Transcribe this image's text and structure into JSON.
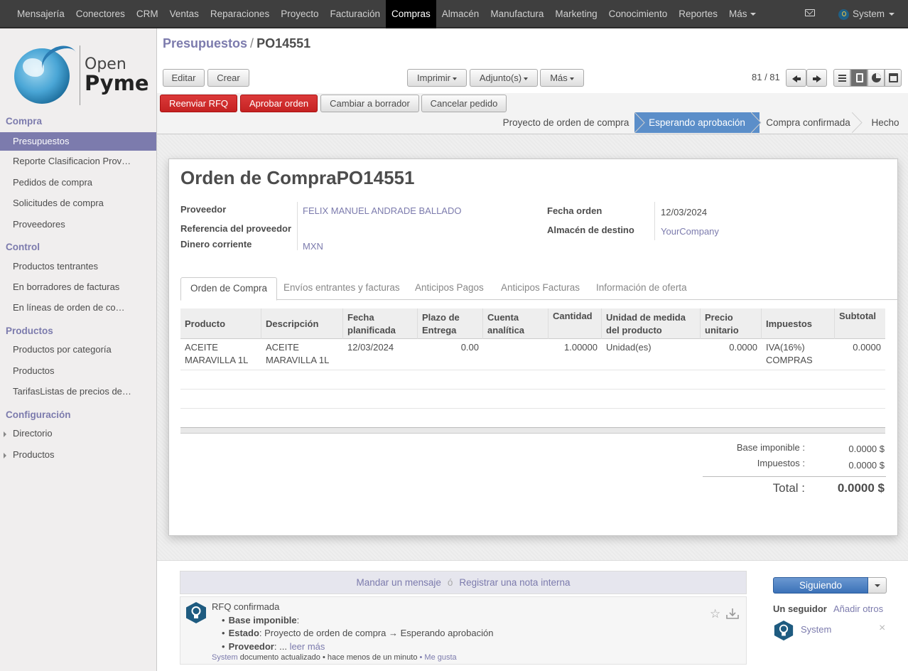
{
  "topbar": {
    "menu": [
      "Mensajería",
      "Conectores",
      "CRM",
      "Ventas",
      "Reparaciones",
      "Proyecto",
      "Facturación",
      "Compras",
      "Almacén",
      "Manufactura",
      "Marketing",
      "Conocimiento",
      "Reportes",
      "Más"
    ],
    "active_menu": "Compras",
    "user": "System"
  },
  "logo": {
    "line1": "Open",
    "line2": "Pyme"
  },
  "sidebar": {
    "sections": [
      {
        "title": "Compra",
        "items": [
          "Presupuestos",
          "Reporte Clasificacion Prov…",
          "Pedidos de compra",
          "Solicitudes de compra",
          "Proveedores"
        ]
      },
      {
        "title": "Control",
        "items": [
          "Productos tentrantes",
          "En borradores de facturas",
          "En líneas de orden de co…"
        ]
      },
      {
        "title": "Productos",
        "items": [
          "Productos por categoría",
          "Productos",
          "TarifasListas de precios de…"
        ]
      },
      {
        "title": "Configuración",
        "items": [
          "Directorio",
          "Productos"
        ]
      }
    ],
    "active_item": "Presupuestos"
  },
  "breadcrumb": {
    "parent": "Presupuestos",
    "sep": "/",
    "current": "PO14551"
  },
  "toolbar": {
    "edit": "Editar",
    "create": "Crear",
    "print": "Imprimir",
    "attach": "Adjunto(s)",
    "more": "Más",
    "pager": "81 / 81"
  },
  "actions": {
    "resend": "Reenviar RFQ",
    "approve": "Aprobar orden",
    "to_draft": "Cambiar a borrador",
    "cancel": "Cancelar pedido"
  },
  "stages": [
    "Proyecto de orden de compra",
    "Esperando aprobación",
    "Compra confirmada",
    "Hecho"
  ],
  "active_stage": "Esperando aprobación",
  "form": {
    "title": "Orden de CompraPO14551",
    "supplier_label": "Proveedor",
    "supplier": "FELIX MANUEL ANDRADE BALLADO",
    "supplier_ref_label": "Referencia del proveedor",
    "currency_label": "Dinero corriente",
    "currency": "MXN",
    "date_label": "Fecha orden",
    "date": "12/03/2024",
    "warehouse_label": "Almacén de destino",
    "warehouse": "YourCompany"
  },
  "tabs": [
    "Orden de Compra",
    "Envíos entrantes y facturas",
    "Anticipos Pagos",
    "Anticipos Facturas",
    "Información de oferta"
  ],
  "grid": {
    "headers": [
      "Producto",
      "Descripción",
      "Fecha planificada",
      "Plazo de Entrega",
      "Cuenta analítica",
      "Cantidad",
      "Unidad de medida del producto",
      "Precio unitario",
      "Impuestos",
      "Subtotal"
    ],
    "rows": [
      {
        "product": "ACEITE MARAVILLA 1L",
        "description": "ACEITE MARAVILLA 1L",
        "date": "12/03/2024",
        "lead": "0.00",
        "analytic": "",
        "qty": "1.00000",
        "uom": "Unidad(es)",
        "price": "0.0000",
        "taxes": "IVA(16%) COMPRAS",
        "subtotal": "0.0000"
      }
    ]
  },
  "totals": {
    "base_label": "Base imponible :",
    "base": "0.0000 $",
    "tax_label": "Impuestos :",
    "tax": "0.0000 $",
    "total_label": "Total :",
    "total": "0.0000 $"
  },
  "chatter": {
    "send_message": "Mandar un mensaje",
    "or": "ó",
    "log_note": "Registrar una nota interna",
    "message": {
      "title": "RFQ confirmada",
      "items": [
        {
          "label": "Base imponible",
          "value": ":"
        },
        {
          "label": "Estado",
          "value": ": Proyecto de orden de compra → Esperando aprobación"
        },
        {
          "label": "Proveedor",
          "value": ": ...",
          "more": "leer más"
        }
      ],
      "author": "System",
      "action": "documento actualizado",
      "time": "• hace menos de un minuto",
      "like": "• Me gusta"
    },
    "follow": "Siguiendo",
    "followers_title": "Un seguidor",
    "add_others": "Añadir otros",
    "follower": "System",
    "remove": "×"
  }
}
